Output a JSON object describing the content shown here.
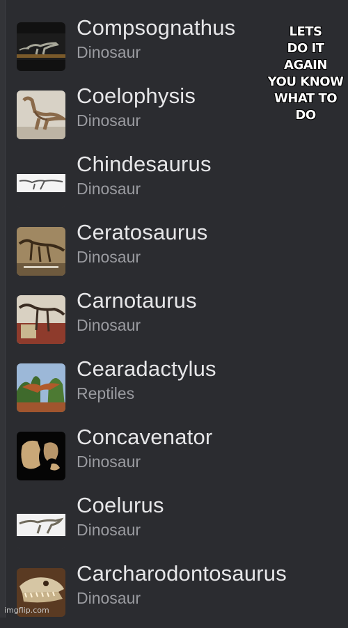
{
  "results": [
    {
      "name": "Compsognathus",
      "category": "Dinosaur",
      "thumb_icon": "compsognathus-image"
    },
    {
      "name": "Coelophysis",
      "category": "Dinosaur",
      "thumb_icon": "coelophysis-image"
    },
    {
      "name": "Chindesaurus",
      "category": "Dinosaur",
      "thumb_icon": "chindesaurus-image"
    },
    {
      "name": "Ceratosaurus",
      "category": "Dinosaur",
      "thumb_icon": "ceratosaurus-skeleton-image"
    },
    {
      "name": "Carnotaurus",
      "category": "Dinosaur",
      "thumb_icon": "carnotaurus-skeleton-image"
    },
    {
      "name": "Cearadactylus",
      "category": "Reptiles",
      "thumb_icon": "cearadactylus-image"
    },
    {
      "name": "Concavenator",
      "category": "Dinosaur",
      "thumb_icon": "concavenator-fossil-image"
    },
    {
      "name": "Coelurus",
      "category": "Dinosaur",
      "thumb_icon": "coelurus-image"
    },
    {
      "name": "Carcharodontosaurus",
      "category": "Dinosaur",
      "thumb_icon": "carcharodontosaurus-skull-image"
    }
  ],
  "caption": {
    "lines": [
      "LETS",
      "DO IT",
      "AGAIN",
      "YOU KNOW",
      "WHAT TO DO"
    ]
  },
  "watermark": "imgflip.com",
  "colors": {
    "background": "#2b2c30",
    "title": "#e6e6e8",
    "subtitle": "#9a9ba0"
  }
}
